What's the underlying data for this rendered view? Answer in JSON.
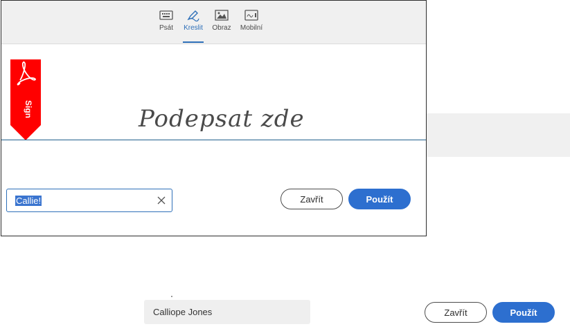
{
  "tabs": [
    {
      "label": "Psát",
      "icon": "keyboard-icon",
      "active": false
    },
    {
      "label": "Kreslit",
      "icon": "pen-icon",
      "active": true
    },
    {
      "label": "Obraz",
      "icon": "image-icon",
      "active": false
    },
    {
      "label": "Mobilní",
      "icon": "mobile-icon",
      "active": false
    }
  ],
  "ribbon": {
    "label": "Sign"
  },
  "signature": {
    "placeholder": "Podepsat zde"
  },
  "name_input": {
    "value": "Callie!"
  },
  "dialog_buttons": {
    "close": "Zavřít",
    "apply": "Použít"
  },
  "background": {
    "name_value": "Calliope Jones",
    "close": "Zavřít",
    "apply": "Použít"
  },
  "colors": {
    "accent": "#2d6fcf",
    "ribbon": "#ff0000",
    "selection": "#3a74cf"
  }
}
